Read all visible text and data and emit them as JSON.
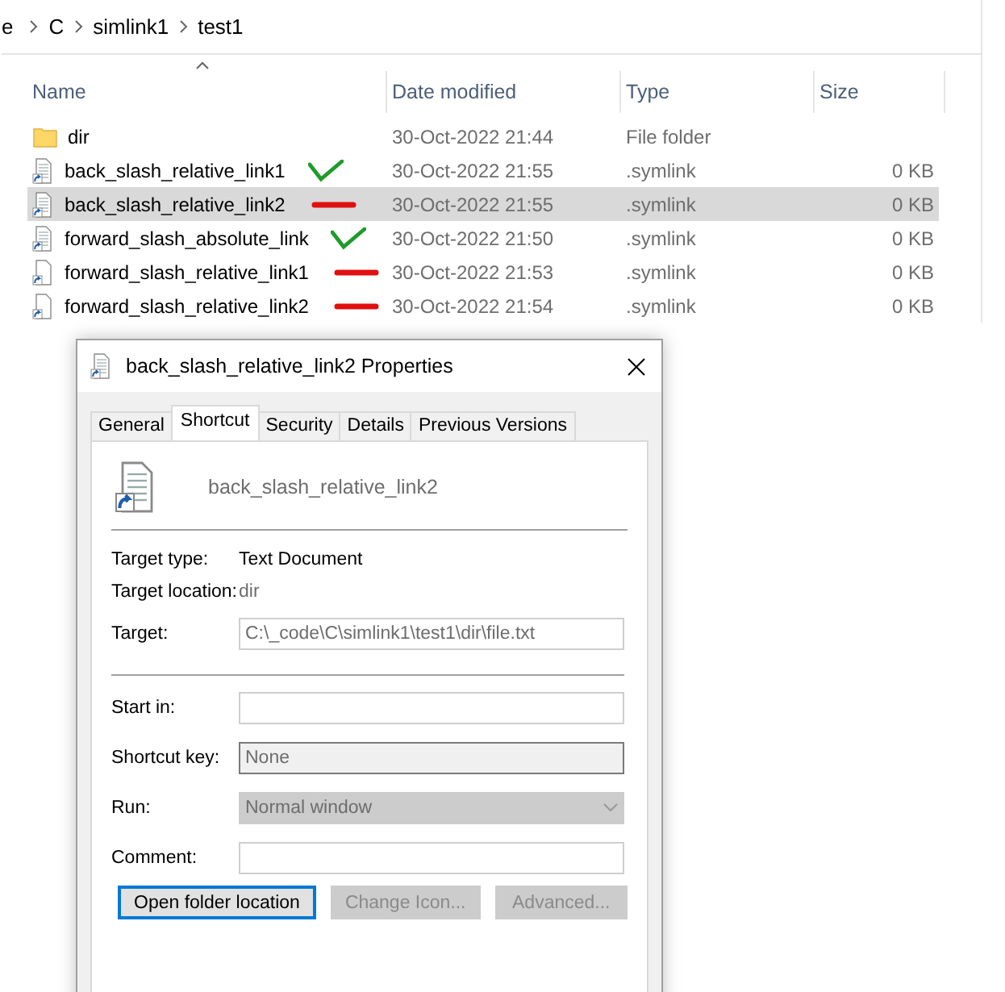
{
  "breadcrumb": [
    "e",
    "C",
    "simlink1",
    "test1"
  ],
  "columns": [
    {
      "label": "Name",
      "sorted": true
    },
    {
      "label": "Date modified"
    },
    {
      "label": "Type"
    },
    {
      "label": "Size"
    }
  ],
  "rows": [
    {
      "kind": "folder",
      "name": "dir",
      "date": "30-Oct-2022 21:44",
      "type": "File folder",
      "selected": false
    },
    {
      "kind": "text_link",
      "name": "back_slash_relative_link1",
      "date": "30-Oct-2022 21:55",
      "type": ".symlink",
      "size": "0 KB",
      "selected": false,
      "marker": {
        "kind": "check"
      }
    },
    {
      "kind": "text_link",
      "name": "back_slash_relative_link2",
      "date": "30-Oct-2022 21:55",
      "type": ".symlink",
      "size": "0 KB",
      "selected": true,
      "marker": {
        "kind": "dash"
      }
    },
    {
      "kind": "text_link",
      "name": "forward_slash_absolute_link",
      "date": "30-Oct-2022 21:50",
      "type": ".symlink",
      "size": "0 KB",
      "selected": false,
      "marker": {
        "kind": "check"
      }
    },
    {
      "kind": "blank_link",
      "name": "forward_slash_relative_link1",
      "date": "30-Oct-2022 21:53",
      "type": ".symlink",
      "size": "0 KB",
      "selected": false,
      "marker": {
        "kind": "dash"
      }
    },
    {
      "kind": "blank_link",
      "name": "forward_slash_relative_link2",
      "date": "30-Oct-2022 21:54",
      "type": ".symlink",
      "size": "0 KB",
      "selected": false,
      "marker": {
        "kind": "dash"
      }
    }
  ],
  "dialog": {
    "title": "back_slash_relative_link2 Properties",
    "tabs": [
      {
        "label": "General",
        "selected": false
      },
      {
        "label": "Shortcut",
        "selected": true
      },
      {
        "label": "Security",
        "selected": false
      },
      {
        "label": "Details",
        "selected": false
      },
      {
        "label": "Previous Versions",
        "selected": false
      }
    ],
    "file_name": "back_slash_relative_link2",
    "info": [
      {
        "label": "Target type:",
        "value": "Text Document",
        "muted": false
      },
      {
        "label": "Target location:",
        "value": "dir",
        "muted": true
      }
    ],
    "target": {
      "label": "Target:",
      "value": "C:\\_code\\C\\simlink1\\test1\\dir\\file.txt"
    },
    "fields": [
      {
        "kind": "input",
        "label": "Start in:"
      },
      {
        "kind": "readonly",
        "label": "Shortcut key:",
        "value": "None"
      },
      {
        "kind": "combo",
        "label": "Run:",
        "value": "Normal window"
      },
      {
        "kind": "input",
        "label": "Comment:"
      }
    ],
    "buttons": [
      {
        "label": "Open folder location",
        "disabled": false,
        "focused": true
      },
      {
        "label": "Change Icon...",
        "disabled": true,
        "focused": false
      },
      {
        "label": "Advanced...",
        "disabled": true,
        "focused": false
      }
    ]
  }
}
